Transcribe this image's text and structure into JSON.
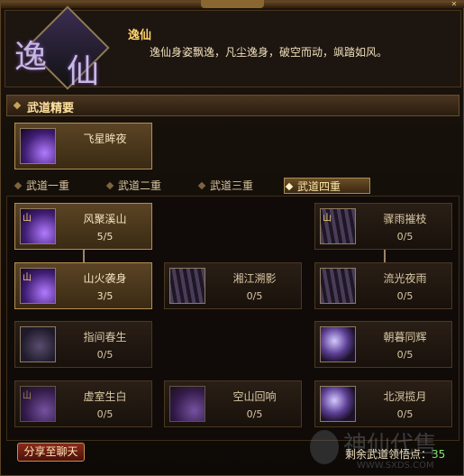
{
  "header": {
    "emblem_chars": [
      "逸",
      "仙"
    ],
    "name": "逸仙",
    "description": "逸仙身姿飘逸，凡尘逸身，破空而动，飒踏如风。"
  },
  "summary": {
    "section_label": "武道精要",
    "card": {
      "name": "飞星眸夜",
      "icon": "purple-slash-icon"
    }
  },
  "tabs": [
    {
      "label": "武道一重",
      "active": false
    },
    {
      "label": "武道二重",
      "active": false
    },
    {
      "label": "武道三重",
      "active": false
    },
    {
      "label": "武道四重",
      "active": true
    }
  ],
  "skills": [
    {
      "name": "风聚溪山",
      "level": "5/5",
      "state": "lit",
      "icon": "purple-slash-icon"
    },
    {
      "name": "骤雨摧枝",
      "level": "0/5",
      "state": "dim",
      "icon": "stripes-icon"
    },
    {
      "name": "山火袭身",
      "level": "3/5",
      "state": "lit",
      "icon": "purple-slash-icon"
    },
    {
      "name": "湘江溯影",
      "level": "0/5",
      "state": "dim",
      "icon": "stripes-icon"
    },
    {
      "name": "流光夜雨",
      "level": "0/5",
      "state": "dim",
      "icon": "stripes-icon"
    },
    {
      "name": "指间春生",
      "level": "0/5",
      "state": "dim",
      "icon": "shadow-icon"
    },
    {
      "name": "朝暮同辉",
      "level": "0/5",
      "state": "dim",
      "icon": "moon-icon"
    },
    {
      "name": "虚室生白",
      "level": "0/5",
      "state": "dim",
      "icon": "purple-slash-icon"
    },
    {
      "name": "空山回响",
      "level": "0/5",
      "state": "dim",
      "icon": "purple-slash-icon"
    },
    {
      "name": "北溟揽月",
      "level": "0/5",
      "state": "dim",
      "icon": "moon-icon"
    }
  ],
  "footer": {
    "share_label": "分享至聊天",
    "remaining_label": "剩余武道领悟点：",
    "remaining_value": "35"
  },
  "watermark": {
    "text": "神仙代售",
    "url": "WWW.SXDS.COM"
  }
}
